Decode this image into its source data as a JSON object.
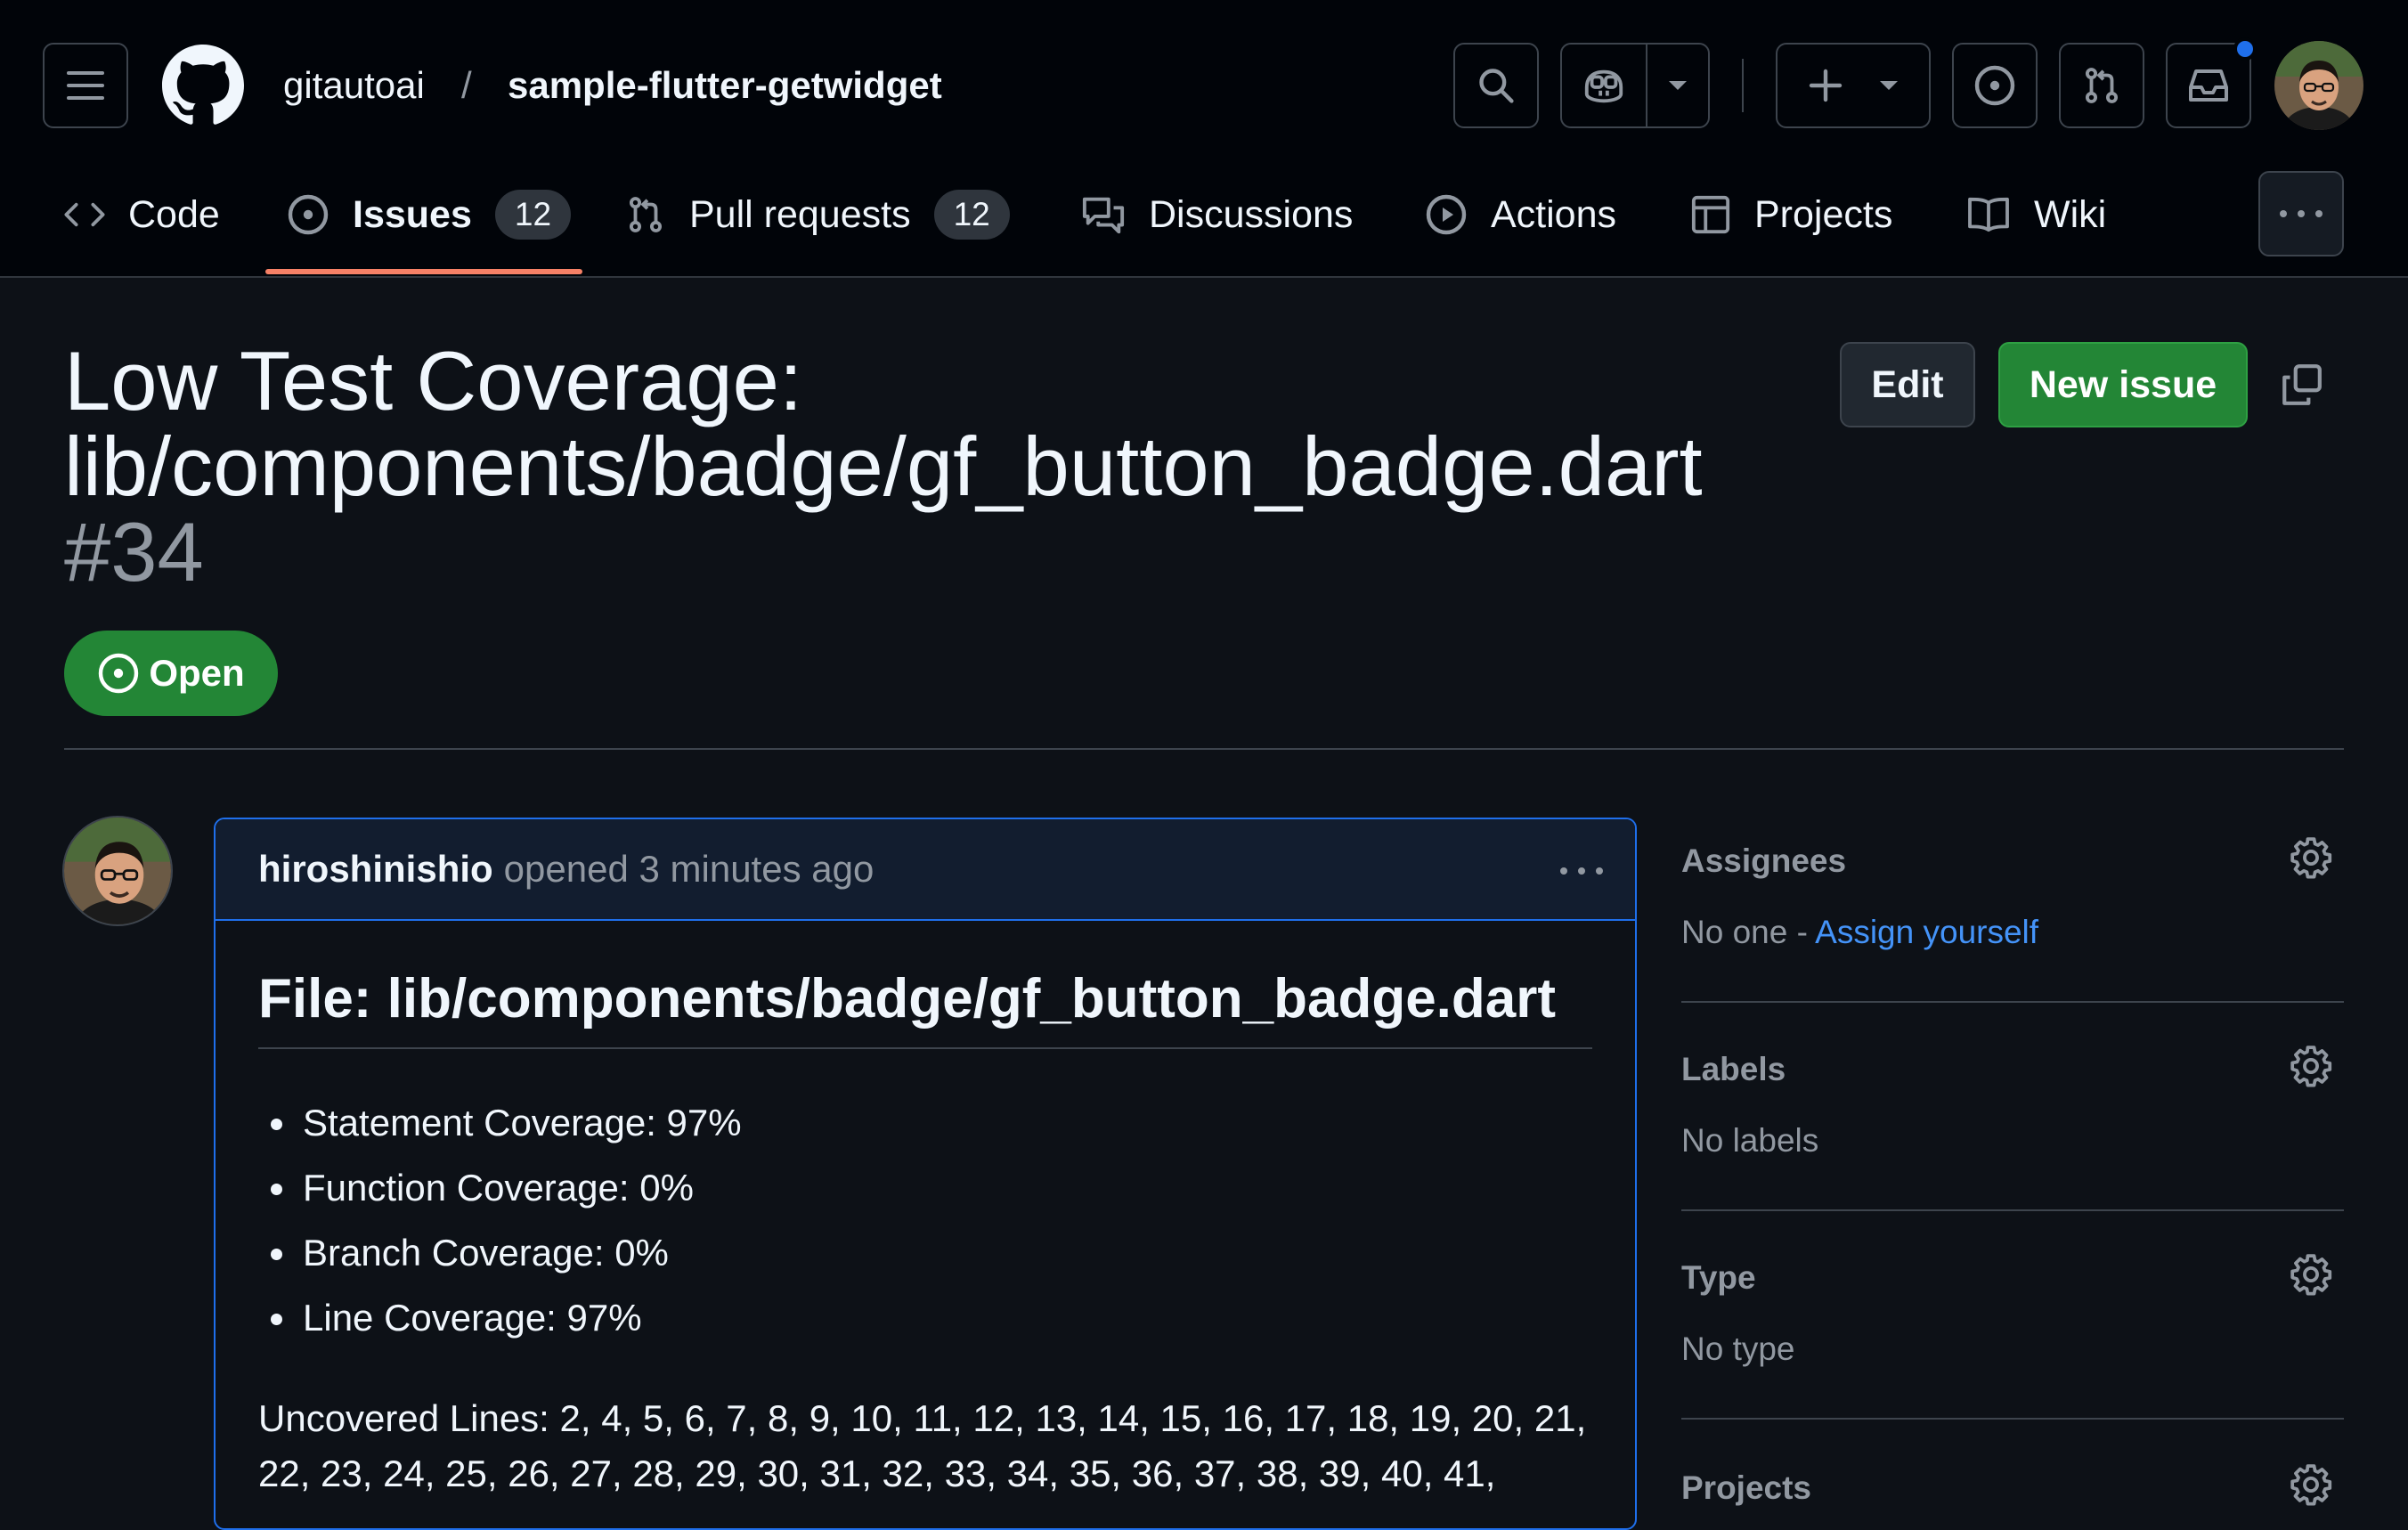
{
  "repo": {
    "owner": "gitautoai",
    "separator": "/",
    "name": "sample-flutter-getwidget"
  },
  "nav": {
    "tabs": [
      {
        "label": "Code"
      },
      {
        "label": "Issues",
        "count": "12"
      },
      {
        "label": "Pull requests",
        "count": "12"
      },
      {
        "label": "Discussions"
      },
      {
        "label": "Actions"
      },
      {
        "label": "Projects"
      },
      {
        "label": "Wiki"
      }
    ],
    "active_tab": "Issues"
  },
  "issue": {
    "title": "Low Test Coverage: lib/components/badge/gf_button_badge.dart",
    "number": "#34",
    "state": "Open",
    "edit_label": "Edit",
    "new_issue_label": "New issue"
  },
  "comment": {
    "author": "hiroshinishio",
    "meta": "opened 3 minutes ago",
    "heading": "File: lib/components/badge/gf_button_badge.dart",
    "items": [
      "Statement Coverage: 97%",
      "Function Coverage: 0%",
      "Branch Coverage: 0%",
      "Line Coverage: 97%"
    ],
    "uncovered": "Uncovered Lines: 2, 4, 5, 6, 7, 8, 9, 10, 11, 12, 13, 14, 15, 16, 17, 18, 19, 20, 21, 22, 23, 24, 25, 26, 27, 28, 29, 30, 31, 32, 33, 34, 35, 36, 37, 38, 39, 40, 41,"
  },
  "sidebar": {
    "assignees": {
      "heading": "Assignees",
      "value": "No one - ",
      "link": "Assign yourself"
    },
    "labels": {
      "heading": "Labels",
      "value": "No labels"
    },
    "type": {
      "heading": "Type",
      "value": "No type"
    },
    "projects": {
      "heading": "Projects"
    }
  },
  "colors": {
    "header_bg": "#010409",
    "page_bg": "#0d1117",
    "accent_green": "#238636",
    "link_blue": "#4493f8",
    "active_tab_underline": "#f78166",
    "notification_dot": "#1f6feb"
  }
}
